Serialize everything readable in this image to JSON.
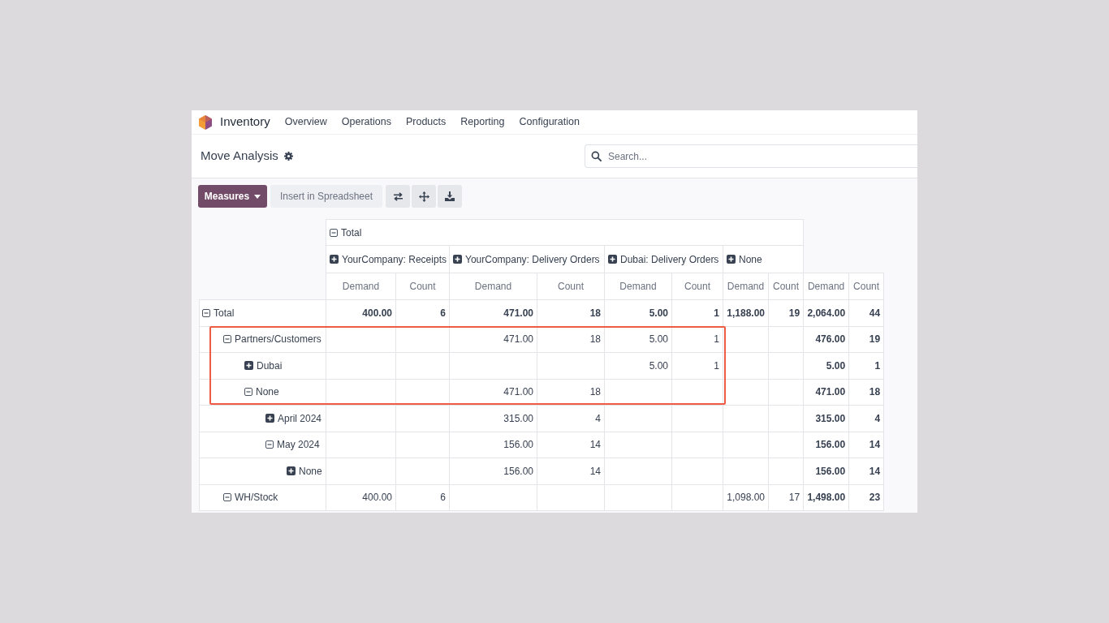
{
  "navbar": {
    "app_name": "Inventory",
    "menu": [
      "Overview",
      "Operations",
      "Products",
      "Reporting",
      "Configuration"
    ]
  },
  "control_panel": {
    "title": "Move Analysis",
    "search": {
      "placeholder": "Search..."
    }
  },
  "toolbar": {
    "measures_button": "Measures",
    "insert_button": "Insert in Spreadsheet"
  },
  "pivot": {
    "column_header": {
      "label": "Total",
      "expanded": true,
      "children": [
        {
          "label": "YourCompany: Receipts",
          "expanded": false,
          "measures": [
            "Demand",
            "Count"
          ]
        },
        {
          "label": "YourCompany: Delivery Orders",
          "expanded": false,
          "measures": [
            "Demand",
            "Count"
          ]
        },
        {
          "label": "Dubai: Delivery Orders",
          "expanded": false,
          "measures": [
            "Demand",
            "Count"
          ]
        },
        {
          "label": "None",
          "expanded": false,
          "measures": [
            "Demand",
            "Count"
          ]
        }
      ]
    },
    "total_measures": [
      "Demand",
      "Count"
    ],
    "rows": [
      {
        "label": "Total",
        "expanded": true,
        "cells": [
          "400.00",
          "6",
          "471.00",
          "18",
          "5.00",
          "1",
          "1,188.00",
          "19",
          "2,064.00",
          "44"
        ],
        "children": [
          {
            "label": "Partners/Customers",
            "expanded": true,
            "cells": [
              null,
              null,
              "471.00",
              "18",
              "5.00",
              "1",
              null,
              null,
              "476.00",
              "19"
            ],
            "children": [
              {
                "label": "Dubai",
                "expanded": false,
                "cells": [
                  null,
                  null,
                  null,
                  null,
                  "5.00",
                  "1",
                  null,
                  null,
                  "5.00",
                  "1"
                ]
              },
              {
                "label": "None",
                "expanded": true,
                "cells": [
                  null,
                  null,
                  "471.00",
                  "18",
                  null,
                  null,
                  null,
                  null,
                  "471.00",
                  "18"
                ],
                "children": [
                  {
                    "label": "April 2024",
                    "expanded": false,
                    "cells": [
                      null,
                      null,
                      "315.00",
                      "4",
                      null,
                      null,
                      null,
                      null,
                      "315.00",
                      "4"
                    ]
                  },
                  {
                    "label": "May 2024",
                    "expanded": true,
                    "cells": [
                      null,
                      null,
                      "156.00",
                      "14",
                      null,
                      null,
                      null,
                      null,
                      "156.00",
                      "14"
                    ],
                    "children": [
                      {
                        "label": "None",
                        "expanded": false,
                        "cells": [
                          null,
                          null,
                          "156.00",
                          "14",
                          null,
                          null,
                          null,
                          null,
                          "156.00",
                          "14"
                        ]
                      }
                    ]
                  }
                ]
              }
            ]
          },
          {
            "label": "WH/Stock",
            "expanded": true,
            "cells": [
              "400.00",
              "6",
              null,
              null,
              null,
              null,
              "1,098.00",
              "17",
              "1,498.00",
              "23"
            ]
          }
        ]
      }
    ]
  }
}
